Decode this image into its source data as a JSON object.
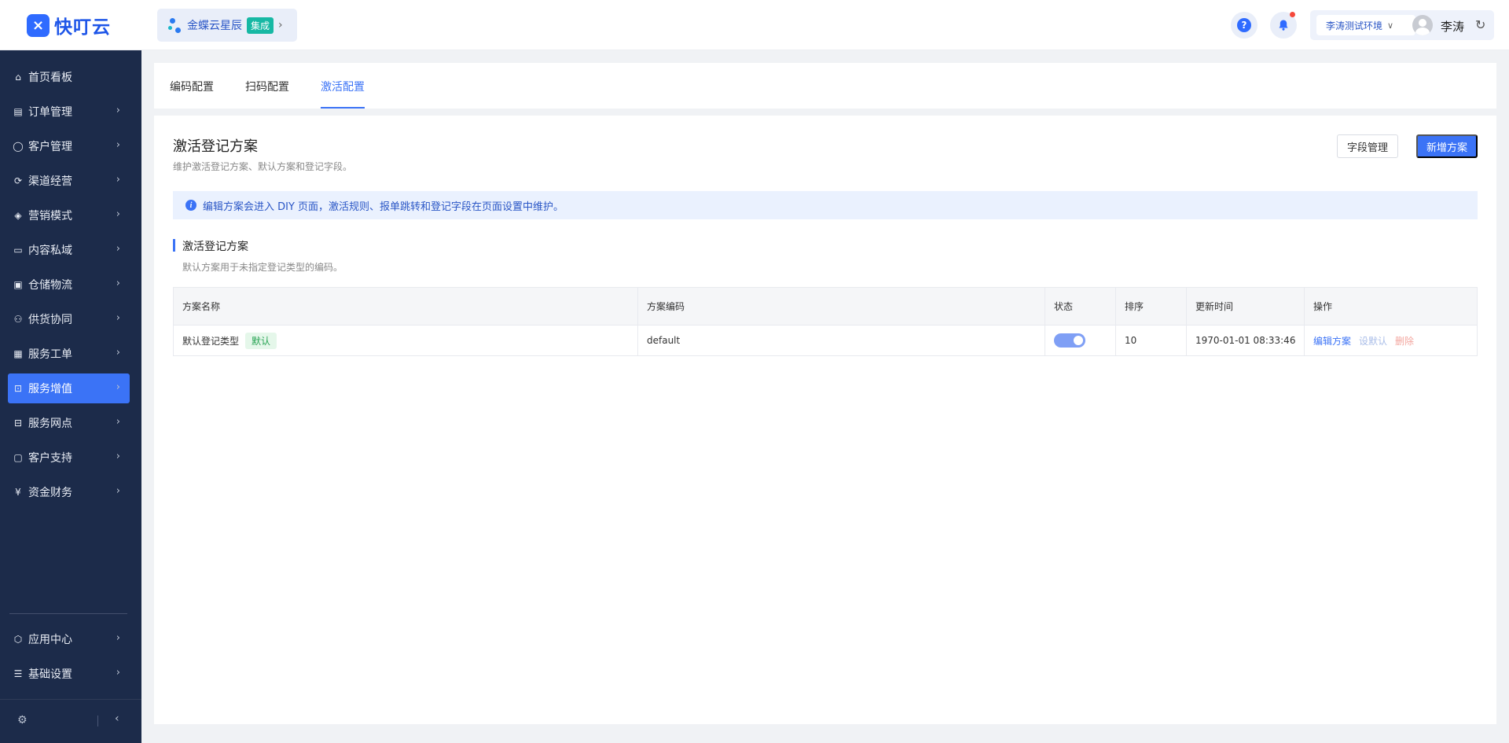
{
  "header": {
    "logo_text": "快叮云",
    "brand_name": "金蝶云星辰",
    "brand_tag": "集成",
    "env_label": "李涛测试环境",
    "username": "李涛"
  },
  "sidebar": {
    "items": [
      {
        "label": "首页看板",
        "icon": "home-icon"
      },
      {
        "label": "订单管理",
        "icon": "order-icon"
      },
      {
        "label": "客户管理",
        "icon": "user-icon"
      },
      {
        "label": "渠道经营",
        "icon": "channel-icon"
      },
      {
        "label": "营销模式",
        "icon": "tag-icon"
      },
      {
        "label": "内容私域",
        "icon": "image-icon"
      },
      {
        "label": "仓储物流",
        "icon": "warehouse-icon"
      },
      {
        "label": "供货协同",
        "icon": "supplier-icon"
      },
      {
        "label": "服务工单",
        "icon": "ticket-icon"
      },
      {
        "label": "服务增值",
        "icon": "bag-icon"
      },
      {
        "label": "服务网点",
        "icon": "store-icon"
      },
      {
        "label": "客户支持",
        "icon": "support-icon"
      },
      {
        "label": "资金财务",
        "icon": "finance-icon"
      }
    ],
    "bottom_items": [
      {
        "label": "应用中心",
        "icon": "cube-icon"
      },
      {
        "label": "基础设置",
        "icon": "settings-list-icon"
      }
    ],
    "active_index": 9
  },
  "tabs": [
    "编码配置",
    "扫码配置",
    "激活配置"
  ],
  "active_tab": 2,
  "page": {
    "title": "激活登记方案",
    "subtitle": "维护激活登记方案、默认方案和登记字段。",
    "btn_fields": "字段管理",
    "btn_add": "新增方案",
    "notice": "编辑方案会进入 DIY 页面，激活规则、报单跳转和登记字段在页面设置中维护。",
    "section_title": "激活登记方案",
    "section_sub": "默认方案用于未指定登记类型的编码。"
  },
  "table": {
    "columns": [
      "方案名称",
      "方案编码",
      "状态",
      "排序",
      "更新时间",
      "操作"
    ],
    "rows": [
      {
        "name": "默认登记类型",
        "tag": "默认",
        "code": "default",
        "enabled": true,
        "sort": "10",
        "updated": "1970-01-01 08:33:46",
        "actions": [
          "编辑方案",
          "设默认",
          "删除"
        ]
      }
    ]
  },
  "colors": {
    "accent": "#3b73f6",
    "sidebar_bg": "#1c2b4a",
    "tag_green": "#27a353",
    "danger_light": "#f3a69f"
  }
}
